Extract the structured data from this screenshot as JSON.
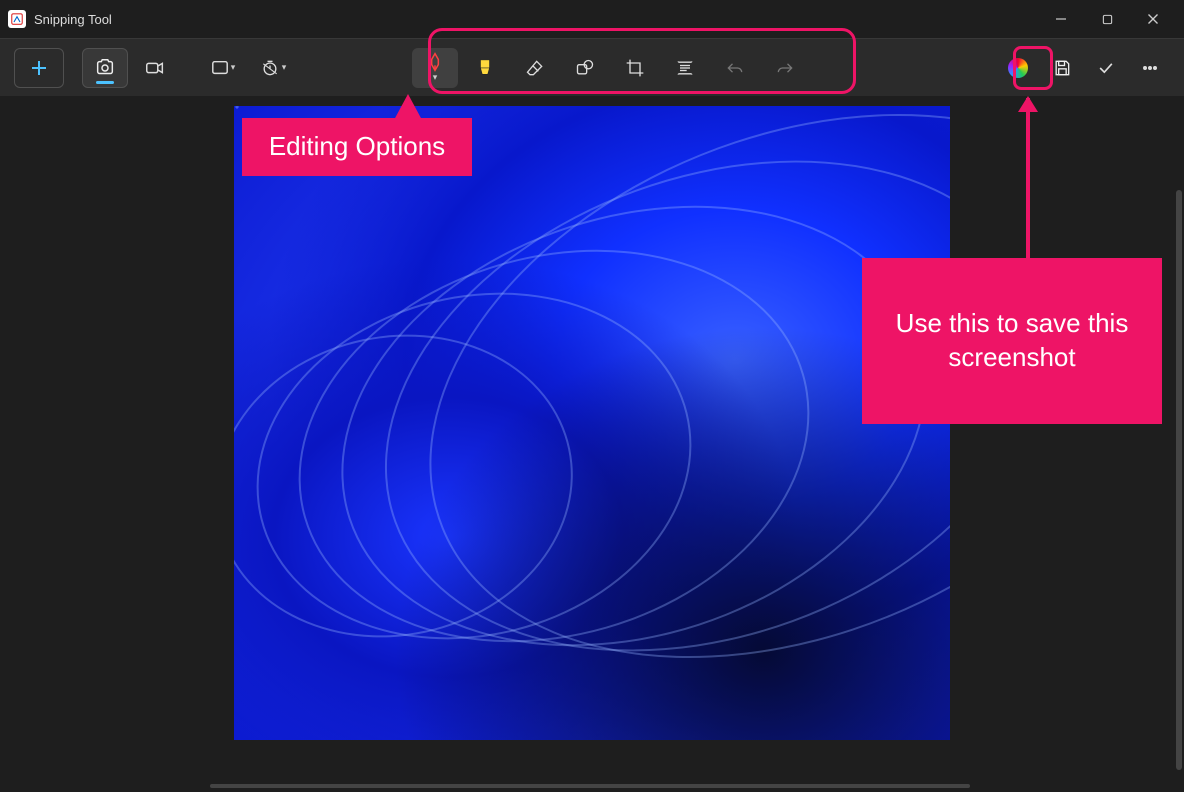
{
  "titlebar": {
    "app_name": "Snipping Tool"
  },
  "toolbar": {
    "new_label": "New",
    "screenshot_label": "Screenshot mode",
    "video_label": "Record mode",
    "shape_label": "Snip shape",
    "delay_label": "Delay",
    "pen_label": "Ballpoint pen",
    "highlighter_label": "Highlighter",
    "eraser_label": "Eraser",
    "shapes_label": "Shapes",
    "crop_label": "Crop",
    "textactions_label": "Text actions",
    "undo_label": "Undo",
    "redo_label": "Redo",
    "color_label": "Color picker",
    "save_label": "Save",
    "apply_label": "Apply",
    "more_label": "More"
  },
  "annotations": {
    "editing_options": "Editing Options",
    "save_hint": "Use this to save this screenshot"
  }
}
